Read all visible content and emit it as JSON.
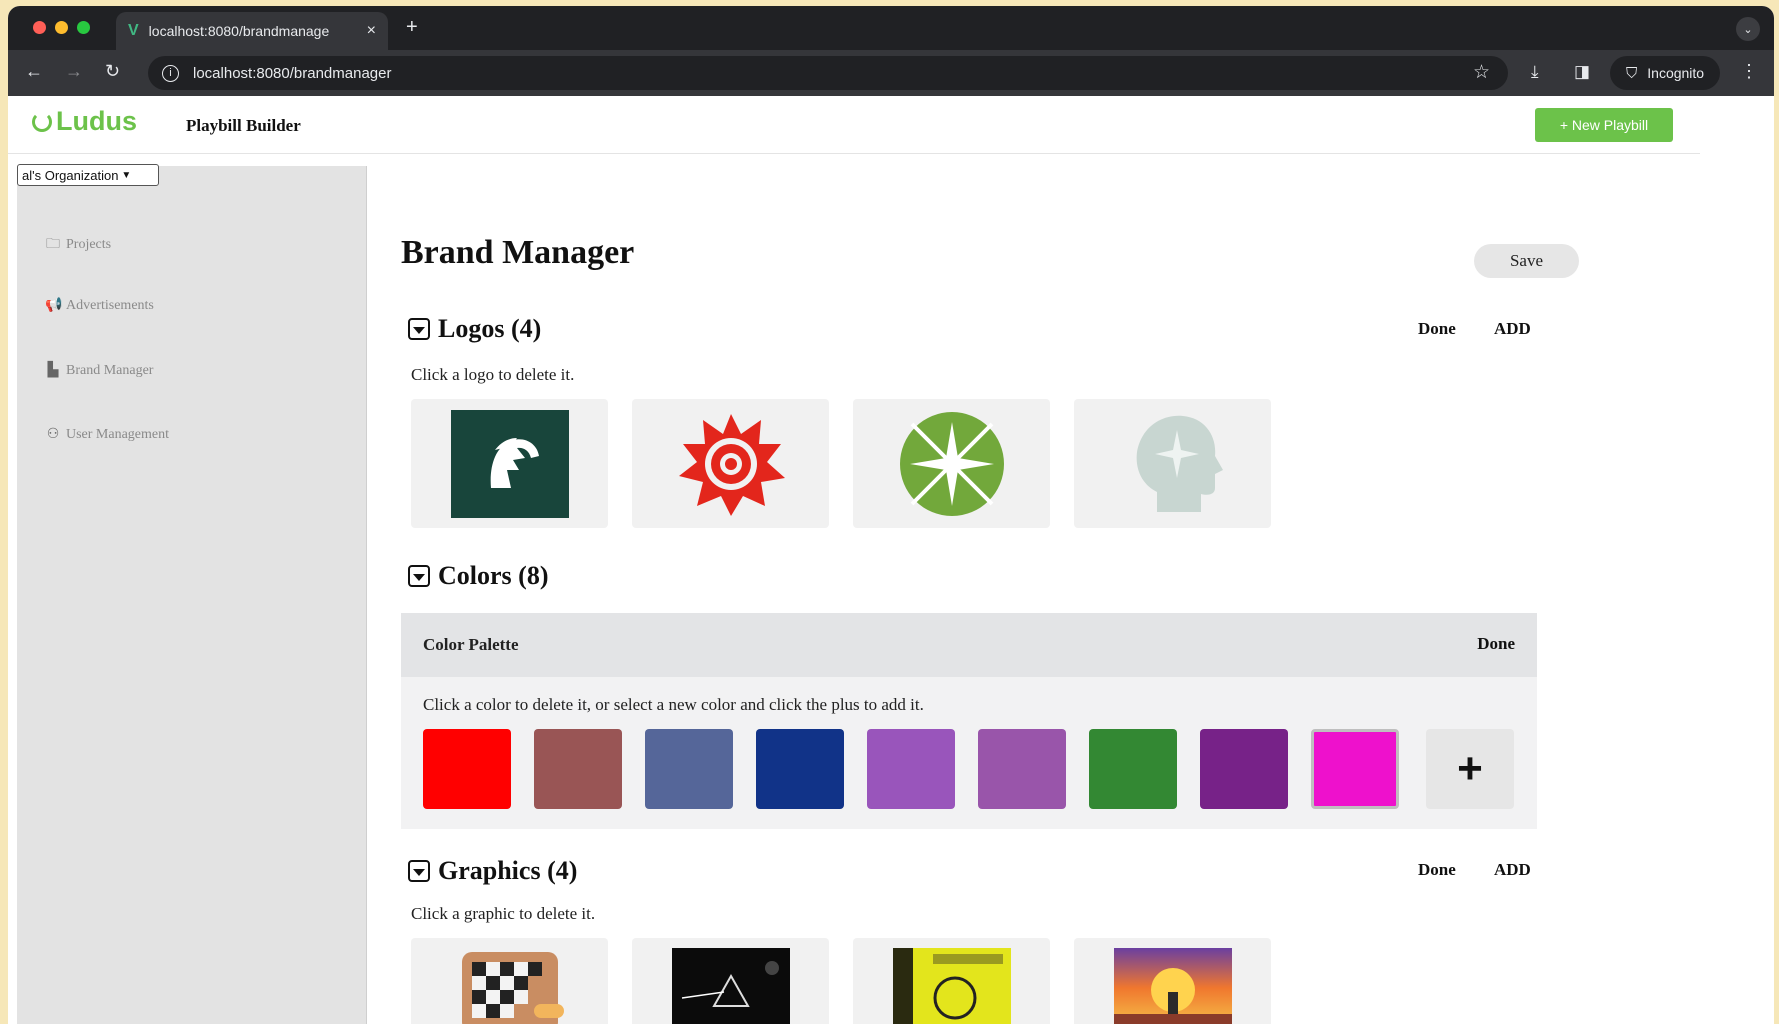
{
  "browser": {
    "tab_title": "localhost:8080/brandmanage",
    "tab_close": "×",
    "new_tab": "+",
    "url": "localhost:8080/brandmanager",
    "incognito_label": "Incognito"
  },
  "header": {
    "brand": "Ludus",
    "app_title": "Playbill Builder",
    "new_playbill_label": "+ New Playbill",
    "org_select_value": "al's Organization"
  },
  "sidebar": {
    "items": [
      {
        "label": "Projects",
        "icon": "folder-icon"
      },
      {
        "label": "Advertisements",
        "icon": "megaphone-icon"
      },
      {
        "label": "Brand Manager",
        "icon": "brand-icon"
      },
      {
        "label": "User Management",
        "icon": "user-icon"
      }
    ]
  },
  "main": {
    "title": "Brand Manager",
    "save_label": "Save",
    "logos": {
      "title": "Logos (4)",
      "done_label": "Done",
      "add_label": "ADD",
      "hint": "Click a logo to delete it.",
      "items": [
        "spartan-logo",
        "red-swirl-logo",
        "green-star-logo",
        "head-star-logo"
      ]
    },
    "colors": {
      "title": "Colors (8)",
      "palette_title": "Color Palette",
      "done_label": "Done",
      "hint": "Click a color to delete it, or select a new color and click the plus to add it.",
      "add_symbol": "+",
      "swatches": [
        "#ff0000",
        "#995555",
        "#556699",
        "#113388",
        "#9955bb",
        "#9955aa",
        "#338833",
        "#772288",
        "#ee11cc"
      ]
    },
    "graphics": {
      "title": "Graphics (4)",
      "done_label": "Done",
      "add_label": "ADD",
      "hint": "Click a graphic to delete it.",
      "items": [
        "checkerboard-graphic",
        "prism-graphic",
        "yellow-album-graphic",
        "sunset-graphic"
      ]
    }
  }
}
